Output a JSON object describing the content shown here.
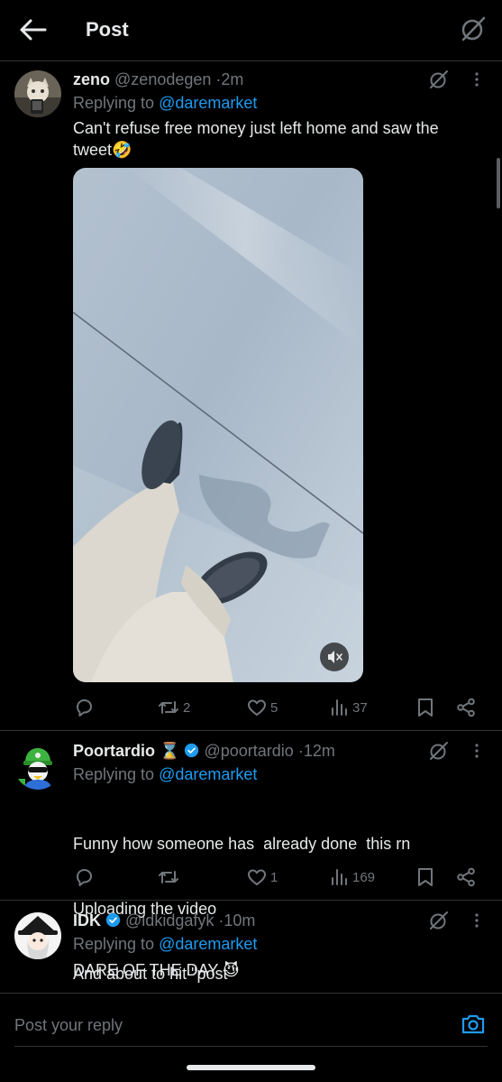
{
  "header": {
    "title": "Post"
  },
  "posts": [
    {
      "name": "zeno",
      "handle": "@zenodegen",
      "time": "2m",
      "replying_prefix": "Replying to ",
      "replying_to": "@daremarket",
      "text_line1": "Can't refuse free money just left home and saw the",
      "text_line2": "tweet🤣",
      "stats": {
        "replies": "",
        "reposts": "2",
        "likes": "5",
        "views": "37"
      }
    },
    {
      "name": "Poortardio",
      "name_emoji": "⌛",
      "handle": "@poortardio",
      "time": "12m",
      "replying_prefix": "Replying to ",
      "replying_to": "@daremarket",
      "text_line1": "Funny how someone has  already done  this rn",
      "text_line2": "Uploading the video",
      "text_line3": "And about to hit \"post \"",
      "stats": {
        "replies": "",
        "reposts": "",
        "likes": "1",
        "views": "169"
      }
    },
    {
      "name": "IDK",
      "handle": "@idkidgafyk",
      "time": "10m",
      "replying_prefix": "Replying to ",
      "replying_to": "@daremarket",
      "text_line1": "DARE OF THE DAY 😈"
    }
  ],
  "reply_bar": {
    "placeholder": "Post your reply"
  },
  "colors": {
    "accent": "#1d9bf0",
    "muted": "#71767b",
    "text": "#e7e9ea",
    "border": "#2f3336",
    "background": "#000000"
  },
  "icons": [
    "back-arrow-icon",
    "grok-icon",
    "more-vertical-icon",
    "reply-icon",
    "repost-icon",
    "like-icon",
    "views-icon",
    "bookmark-icon",
    "share-icon",
    "mute-icon",
    "verified-badge-icon",
    "camera-icon"
  ]
}
